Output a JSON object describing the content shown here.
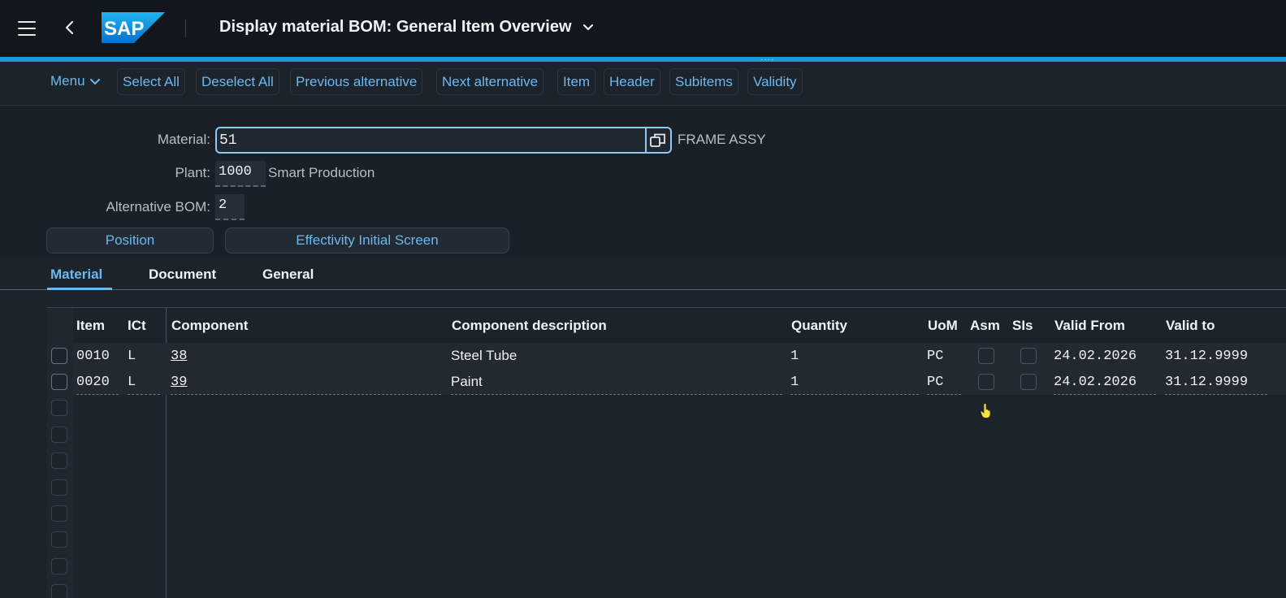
{
  "shell": {
    "menu_icon": "hamburger-icon",
    "back_icon": "chevron-left-icon",
    "logo_text": "SAP",
    "title": "Display material BOM: General Item Overview",
    "accent_color": "#1b9ad6"
  },
  "toolbar": {
    "menu": "Menu",
    "select_all": "Select All",
    "deselect_all": "Deselect All",
    "previous_alternative": "Previous alternative",
    "next_alternative": "Next alternative",
    "item": "Item",
    "header": "Header",
    "subitems": "Subitems",
    "validity": "Validity"
  },
  "form": {
    "material_label": "Material:",
    "material_value": "51",
    "material_desc": "FRAME ASSY",
    "plant_label": "Plant:",
    "plant_value": "1000",
    "plant_desc": "Smart Production",
    "alt_bom_label": "Alternative BOM:",
    "alt_bom_value": "2",
    "position_button": "Position",
    "effectivity_button": "Effectivity Initial Screen"
  },
  "tabs": [
    "Material",
    "Document",
    "General"
  ],
  "table": {
    "columns": [
      "Item",
      "ICt",
      "Component",
      "Component description",
      "Quantity",
      "UoM",
      "Asm",
      "SIs",
      "Valid From",
      "Valid to"
    ],
    "rows": [
      {
        "item": "0010",
        "ict": "L",
        "component": "38",
        "description": "Steel Tube",
        "quantity": "1",
        "uom": "PC",
        "valid_from": "24.02.2026",
        "valid_to": "31.12.9999"
      },
      {
        "item": "0020",
        "ict": "L",
        "component": "39",
        "description": "Paint",
        "quantity": "1",
        "uom": "PC",
        "valid_from": "24.02.2026",
        "valid_to": "31.12.9999"
      }
    ]
  }
}
